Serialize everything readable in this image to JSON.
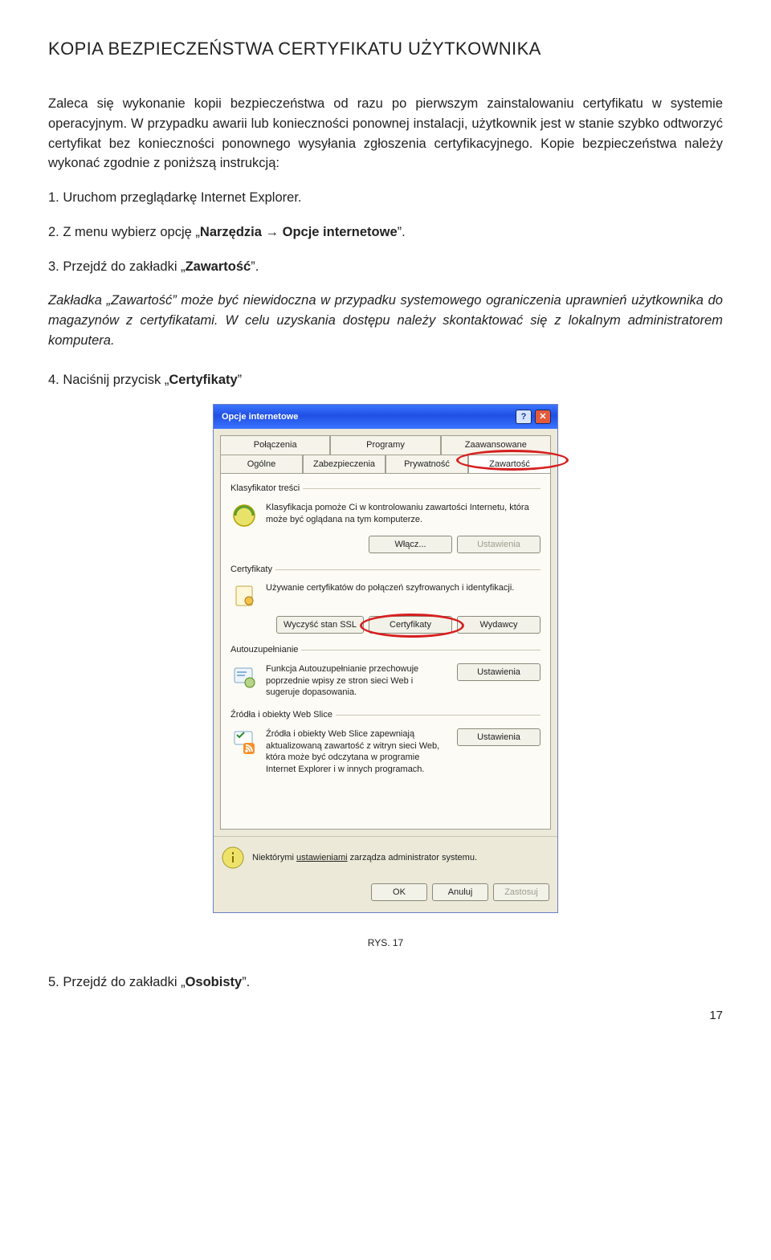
{
  "doc": {
    "heading": "KOPIA BEZPIECZEŃSTWA CERTYFIKATU UŻYTKOWNIKA",
    "para1": "Zaleca się wykonanie kopii bezpieczeństwa od razu po pierwszym zainstalowaniu certyfikatu w systemie operacyjnym. W przypadku awarii lub konieczności ponownej instalacji, użytkownik jest w stanie szybko odtworzyć certyfikat bez konieczności ponownego wysyłania zgłoszenia certyfikacyjnego. Kopie bezpieczeństwa należy wykonać zgodnie z poniższą instrukcją:",
    "step1": "1. Uruchom przeglądarkę Internet Explorer.",
    "step2a": "2. Z menu wybierz opcję „",
    "step2b": "Narzędzia → Opcje internetowe",
    "step2c": "”.",
    "step3a": "3. Przejdź do zakładki „",
    "step3b": "Zawartość",
    "step3c": "”.",
    "italic_note": "Zakładka „Zawartość” może być niewidoczna w przypadku systemowego ograniczenia uprawnień użytkownika do magazynów z certyfikatami. W celu uzyskania dostępu należy skontaktować się z lokalnym administratorem komputera.",
    "step4a": "4. Naciśnij przycisk „",
    "step4b": "Certyfikaty",
    "step4c": "”",
    "caption": "RYS. 17",
    "step5a": "5. Przejdź do zakładki „",
    "step5b": "Osobisty",
    "step5c": "”.",
    "page_num": "17"
  },
  "dialog": {
    "title": "Opcje internetowe",
    "tabs_row1": [
      "Połączenia",
      "Programy",
      "Zaawansowane"
    ],
    "tabs_row2": [
      "Ogólne",
      "Zabezpieczenia",
      "Prywatność",
      "Zawartość"
    ],
    "section_klas": {
      "legend": "Klasyfikator treści",
      "text": "Klasyfikacja pomoże Ci w kontrolowaniu zawartości Internetu, która może być oglądana na tym komputerze.",
      "btn_enable": "Włącz...",
      "btn_settings": "Ustawienia"
    },
    "section_cert": {
      "legend": "Certyfikaty",
      "text": "Używanie certyfikatów do połączeń szyfrowanych i identyfikacji.",
      "btn_clear": "Wyczyść stan SSL",
      "btn_cert": "Certyfikaty",
      "btn_pub": "Wydawcy"
    },
    "section_auto": {
      "legend": "Autouzupełnianie",
      "text": "Funkcja Autouzupełnianie przechowuje poprzednie wpisy ze stron sieci Web i sugeruje dopasowania.",
      "btn_settings": "Ustawienia"
    },
    "section_feed": {
      "legend": "Źródła i obiekty Web Slice",
      "text": "Źródła i obiekty Web Slice zapewniają aktualizowaną zawartość z witryn sieci Web, która może być odczytana w programie Internet Explorer i w innych programach.",
      "btn_settings": "Ustawienia"
    },
    "footer_note_a": "Niektórymi ",
    "footer_note_link": "ustawieniami",
    "footer_note_b": " zarządza administrator systemu.",
    "ok": "OK",
    "cancel": "Anuluj",
    "apply": "Zastosuj"
  }
}
